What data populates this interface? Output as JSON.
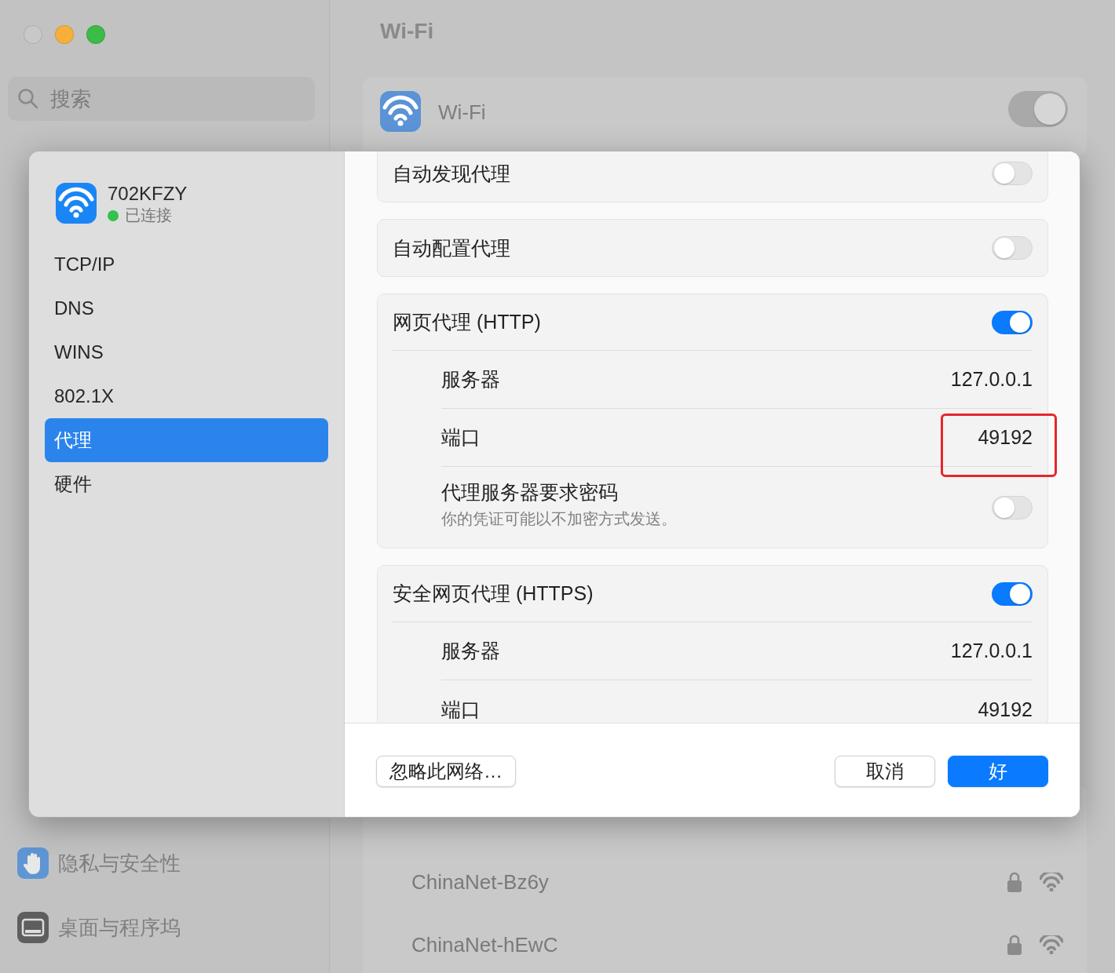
{
  "window": {
    "title": "Wi-Fi"
  },
  "sidebar": {
    "search": {
      "placeholder": "搜索"
    },
    "items": [
      {
        "label": "隐私与安全性"
      },
      {
        "label": "桌面与程序坞"
      }
    ]
  },
  "wifi_row": {
    "label": "Wi-Fi",
    "on": true
  },
  "networks": [
    {
      "name": "ChinaNet-Bz6y",
      "locked": true
    },
    {
      "name": "ChinaNet-hEwC",
      "locked": true
    }
  ],
  "dialog": {
    "network": {
      "name": "702KFZY",
      "status": "已连接",
      "connected": true
    },
    "tabs": [
      {
        "label": "TCP/IP",
        "selected": false
      },
      {
        "label": "DNS",
        "selected": false
      },
      {
        "label": "WINS",
        "selected": false
      },
      {
        "label": "802.1X",
        "selected": false
      },
      {
        "label": "代理",
        "selected": true
      },
      {
        "label": "硬件",
        "selected": false
      }
    ],
    "sections": [
      {
        "label": "自动发现代理",
        "on": false
      },
      {
        "label": "自动配置代理",
        "on": false
      },
      {
        "label": "网页代理 (HTTP)",
        "on": true,
        "fields": [
          {
            "kind": "value",
            "label": "服务器",
            "value": "127.0.0.1",
            "highlighted": false
          },
          {
            "kind": "value",
            "label": "端口",
            "value": "49192",
            "highlighted": true
          },
          {
            "kind": "switch",
            "label": "代理服务器要求密码",
            "note": "你的凭证可能以不加密方式发送。",
            "on": false
          }
        ]
      },
      {
        "label": "安全网页代理 (HTTPS)",
        "on": true,
        "fields": [
          {
            "kind": "value",
            "label": "服务器",
            "value": "127.0.0.1",
            "highlighted": false
          },
          {
            "kind": "value",
            "label": "端口",
            "value": "49192",
            "highlighted": false
          }
        ]
      }
    ],
    "buttons": [
      {
        "label": "忽略此网络…",
        "kind": "secondary"
      },
      {
        "label": "取消",
        "kind": "secondary"
      },
      {
        "label": "好",
        "kind": "primary"
      }
    ]
  }
}
